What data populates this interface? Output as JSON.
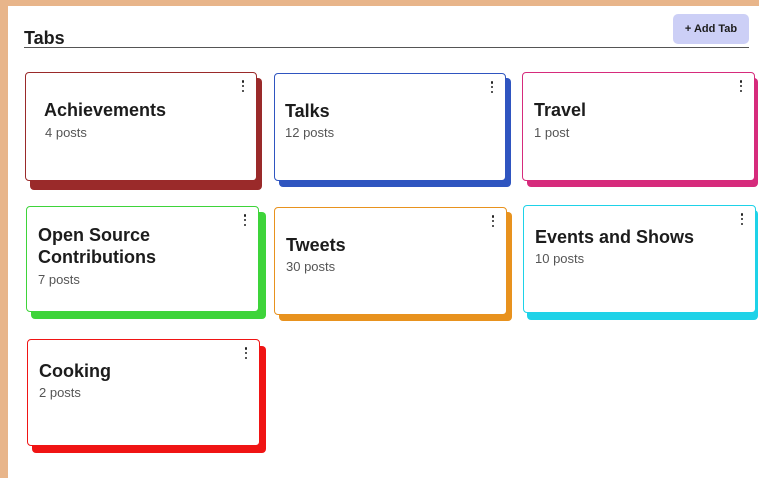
{
  "header": {
    "title": "Tabs",
    "add_button_label": "+ Add Tab"
  },
  "colors": {
    "page_background": "#e8b58a",
    "add_button_bg": "#cccff6"
  },
  "cards": [
    {
      "title": "Achievements",
      "count": "4 posts",
      "color": "#9a2a2a"
    },
    {
      "title": "Talks",
      "count": "12 posts",
      "color": "#2f55c0"
    },
    {
      "title": "Travel",
      "count": "1 post",
      "color": "#d62b7c"
    },
    {
      "title": "Open Source Contributions",
      "count": "7 posts",
      "color": "#3ed43a"
    },
    {
      "title": "Tweets",
      "count": "30 posts",
      "color": "#e8921e"
    },
    {
      "title": "Events and Shows",
      "count": "10 posts",
      "color": "#1ed2e8"
    },
    {
      "title": "Cooking",
      "count": "2 posts",
      "color": "#f01414"
    }
  ]
}
